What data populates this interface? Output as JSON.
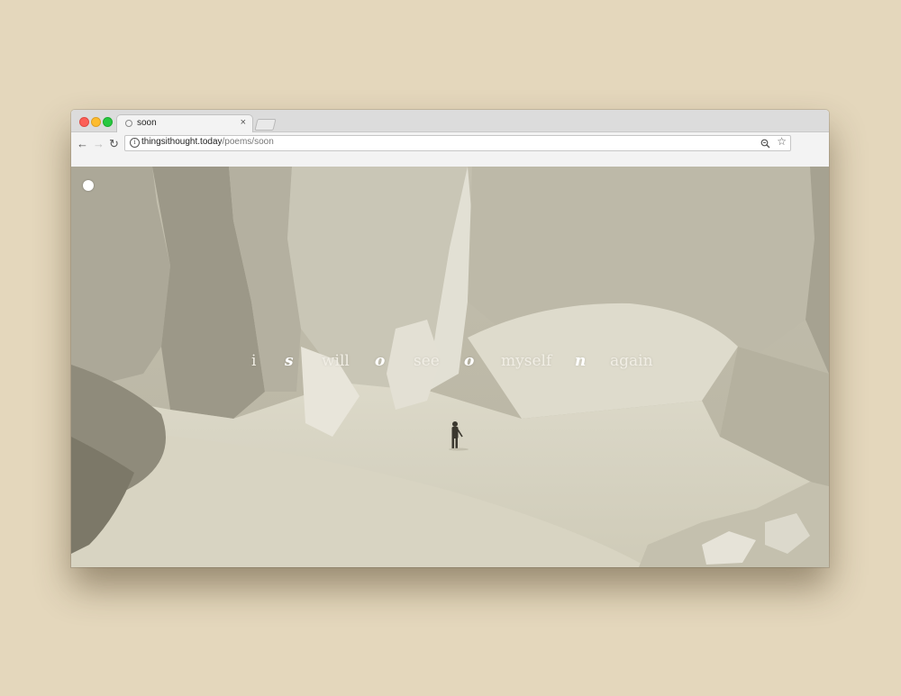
{
  "browser": {
    "tab": {
      "title": "soon",
      "close_label": "×"
    },
    "address_bar": {
      "domain": "thingsithought.today",
      "path": "/poems/soon"
    }
  },
  "page": {
    "poem_words": [
      {
        "text": "i",
        "accent": false
      },
      {
        "text": "s",
        "accent": true
      },
      {
        "text": "will",
        "accent": false
      },
      {
        "text": "o",
        "accent": true
      },
      {
        "text": "see",
        "accent": false
      },
      {
        "text": "o",
        "accent": true
      },
      {
        "text": "myself",
        "accent": false
      },
      {
        "text": "n",
        "accent": true
      },
      {
        "text": "again",
        "accent": false
      }
    ]
  },
  "colors": {
    "desktop_background": "#e4d7bc",
    "photo_tone": "#cfcbb9"
  }
}
